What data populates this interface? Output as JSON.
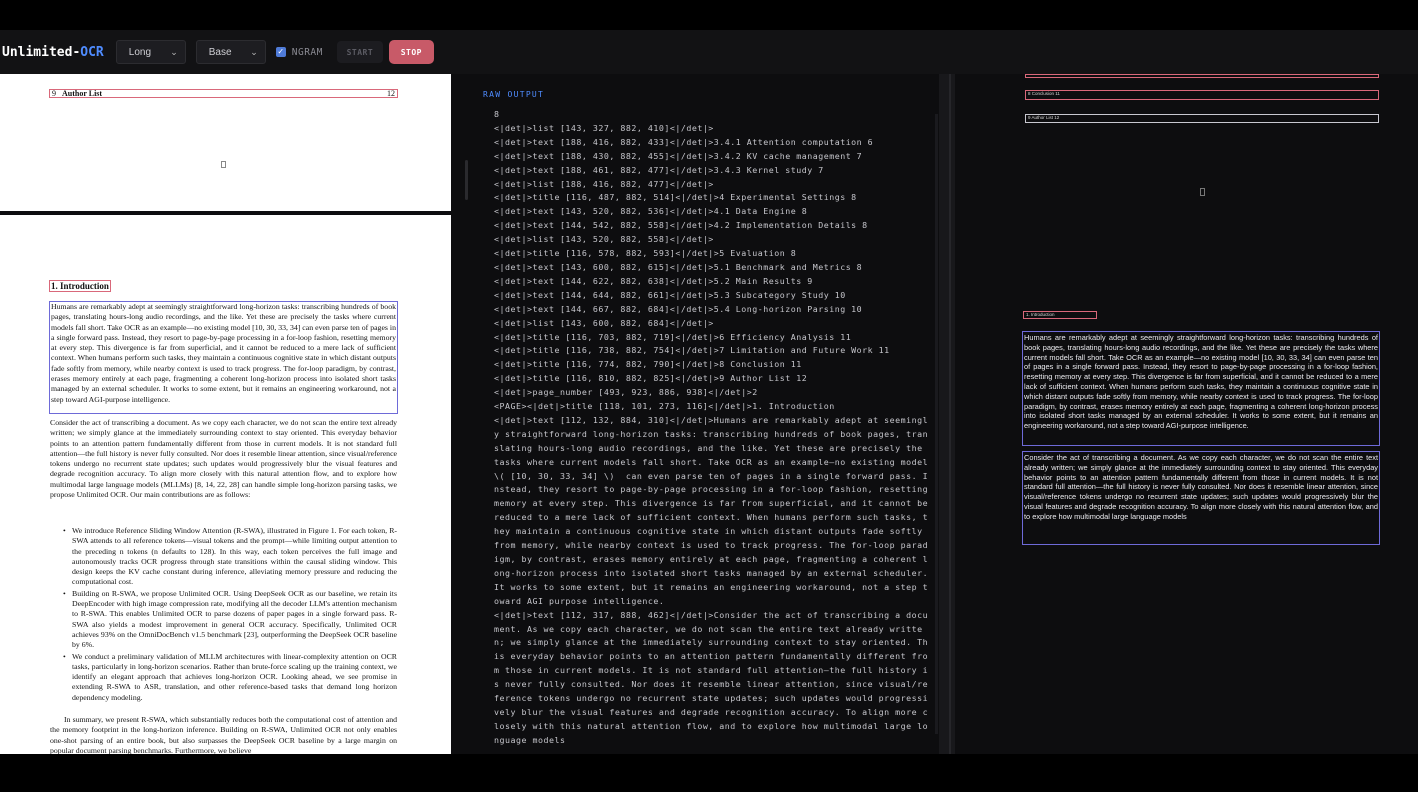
{
  "app": {
    "brand_prefix": "Unlimited-",
    "brand_accent": "OCR",
    "accent_color": "#4f8cff",
    "stop_color": "#c85a68"
  },
  "toolbar": {
    "mode_select": "Long",
    "model_select": "Base",
    "ngram_label": "NGRAM",
    "ngram_checked": true,
    "start_label": "START",
    "stop_label": "STOP"
  },
  "document": {
    "page1": {
      "author_list_num": "9",
      "author_list_title": "Author List",
      "author_list_page": "12"
    },
    "page2": {
      "intro_heading": "1.  Introduction",
      "intro_para": "Humans are remarkably adept at seemingly straightforward long-horizon tasks: transcribing hundreds of book pages, translating hours-long audio recordings, and the like. Yet these are precisely the tasks where current models fall short. Take OCR as an example—no existing model [10, 30, 33, 34] can even parse ten of pages in a single forward pass. Instead, they resort to page-by-page processing in a for-loop fashion, resetting memory at every step. This divergence is far from superficial, and it cannot be reduced to a mere lack of sufficient context. When humans perform such tasks, they maintain a continuous cognitive state in which distant outputs fade softly from memory, while nearby context is used to track progress. The for-loop paradigm, by contrast, erases memory entirely at each page, fragmenting a coherent long-horizon process into isolated short tasks managed by an external scheduler. It works to some extent, but it remains an engineering workaround, not a step toward AGI-purpose intelligence.",
      "consider_para": "Consider the act of transcribing a document. As we copy each character, we do not scan the entire text already written; we simply glance at the immediately surrounding context to stay oriented. This everyday behavior points to an attention pattern fundamentally different from those in current models. It is not standard full attention—the full history is never fully consulted. Nor does it resemble linear attention, since visual/reference tokens undergo no recurrent state updates; such updates would progressively blur the visual features and degrade recognition accuracy. To align more closely with this natural attention flow, and to explore how multimodal large language models (MLLMs) [8, 14, 22, 28] can handle simple long-horizon parsing tasks, we propose Unlimited OCR. Our main contributions are as follows:",
      "bullets": [
        "We introduce Reference Sliding Window Attention (R-SWA), illustrated in Figure 1. For each token, R-SWA attends to all reference tokens—visual tokens and the prompt—while limiting output attention to the preceding n tokens (n defaults to 128). In this way, each token perceives the full image and autonomously tracks OCR progress through state transitions within the causal sliding window. This design keeps the KV cache constant during inference, alleviating memory pressure and reducing the computational cost.",
        "Building on R-SWA, we propose Unlimited OCR. Using DeepSeek OCR as our baseline, we retain its DeepEncoder with high image compression rate, modifying all the decoder LLM's attention mechanism to R-SWA. This enables Unlimited OCR to parse dozens of paper pages in a single forward pass. R-SWA also yields a modest improvement in general OCR accuracy. Specifically, Unlimited OCR achieves 93% on the OmniDocBench v1.5 benchmark [23], outperforming the DeepSeek OCR baseline by 6%.",
        "We conduct a preliminary validation of MLLM architectures with linear-complexity attention on OCR tasks, particularly in long-horizon scenarios. Rather than brute-force scaling up the training context, we identify an elegant approach that achieves long-horizon OCR. Looking ahead, we see promise in extending R-SWA to ASR, translation, and other reference-based tasks that demand long horizon dependency modeling."
      ],
      "summary_para": "In summary, we present R-SWA, which substantially reduces both the computational cost of attention and the memory footprint in the long-horizon inference. Building on R-SWA, Unlimited OCR not only enables one-shot parsing of an entire book, but also surpasses the DeepSeek OCR baseline by a large margin on popular document parsing benchmarks. Furthermore, we believe"
    }
  },
  "raw_output": {
    "title": "RAW OUTPUT",
    "text": "8\n<|det|>list [143, 327, 882, 410]<|/det|>\n<|det|>text [188, 416, 882, 433]<|/det|>3.4.1 Attention computation 6\n<|det|>text [188, 430, 882, 455]<|/det|>3.4.2 KV cache management 7\n<|det|>text [188, 461, 882, 477]<|/det|>3.4.3 Kernel study 7\n<|det|>list [188, 416, 882, 477]<|/det|>\n<|det|>title [116, 487, 882, 514]<|/det|>4 Experimental Settings 8\n<|det|>text [143, 520, 882, 536]<|/det|>4.1 Data Engine 8\n<|det|>text [144, 542, 882, 558]<|/det|>4.2 Implementation Details 8\n<|det|>list [143, 520, 882, 558]<|/det|>\n<|det|>title [116, 578, 882, 593]<|/det|>5 Evaluation 8\n<|det|>text [143, 600, 882, 615]<|/det|>5.1 Benchmark and Metrics 8\n<|det|>text [144, 622, 882, 638]<|/det|>5.2 Main Results 9\n<|det|>text [144, 644, 882, 661]<|/det|>5.3 Subcategory Study 10\n<|det|>text [144, 667, 882, 684]<|/det|>5.4 Long-horizon Parsing 10\n<|det|>list [143, 600, 882, 684]<|/det|>\n<|det|>title [116, 703, 882, 719]<|/det|>6 Efficiency Analysis 11\n<|det|>title [116, 738, 882, 754]<|/det|>7 Limitation and Future Work 11\n<|det|>title [116, 774, 882, 790]<|/det|>8 Conclusion 11\n<|det|>title [116, 810, 882, 825]<|/det|>9 Author List 12\n<|det|>page_number [493, 923, 886, 938]<|/det|>2\n<PAGE><|det|>title [118, 101, 273, 116]<|/det|>1. Introduction\n<|det|>text [112, 132, 884, 310]<|/det|>Humans are remarkably adept at seemingl\ny straightforward long-horizon tasks: transcribing hundreds of book pages, tran\nslating hours-long audio recordings, and the like. Yet these are precisely the\ntasks where current models fall short. Take OCR as an example—no existing model\n\\( [10, 30, 33, 34] \\)  can even parse ten of pages in a single forward pass. I\nnstead, they resort to page-by-page processing in a for-loop fashion, resetting\nmemory at every step. This divergence is far from superficial, and it cannot be\nreduced to a mere lack of sufficient context. When humans perform such tasks, t\nhey maintain a continuous cognitive state in which distant outputs fade softly\nfrom memory, while nearby context is used to track progress. The for-loop parad\nigm, by contrast, erases memory entirely at each page, fragmenting a coherent l\nong-horizon process into isolated short tasks managed by an external scheduler.\nIt works to some extent, but it remains an engineering workaround, not a step t\noward AGI purpose intelligence.\n<|det|>text [112, 317, 888, 462]<|/det|>Consider the act of transcribing a docu\nment. As we copy each character, we do not scan the entire text already writte\nn; we simply glance at the immediately surrounding context to stay oriented. Th\nis everyday behavior points to an attention pattern fundamentally different fro\nm those in current models. It is not standard full attention—the full history i\ns never fully consulted. Nor does it resemble linear attention, since visual/re\nference tokens undergo no recurrent state updates; such updates would progressi\nvely blur the visual features and degrade recognition accuracy. To align more c\nlosely with this natural attention flow, and to explore how multimodal large lo\nnguage models"
  },
  "visualization": {
    "box_conclusion": "8 Conclusion 11",
    "box_author_list": "9 Author List 12",
    "box_introduction": "1. Introduction",
    "intro_text": "Humans are remarkably adept at seemingly straightforward long-horizon tasks: transcribing hundreds of book pages, translating hours-long audio recordings, and the like. Yet these are precisely the tasks where current models fall short. Take OCR as an example—no existing model [10, 30, 33, 34] can even parse ten of pages in a single forward pass. Instead, they resort to page-by-page processing in a for-loop fashion, resetting memory at every step. This divergence is far from superficial, and it cannot be reduced to a mere lack of sufficient context. When humans perform such tasks, they maintain a continuous cognitive state in which distant outputs fade softly from memory, while nearby context is used to track progress. The for-loop paradigm, by contrast, erases memory entirely at each page, fragmenting a coherent long-horizon process into isolated short tasks managed by an external scheduler. It works to some extent, but it remains an engineering workaround, not a step toward AGI-purpose intelligence.",
    "consider_text": "Consider the act of transcribing a document. As we copy each character, we do not scan the entire text already written; we simply glance at the immediately surrounding context to stay oriented. This everyday behavior points to an attention pattern fundamentally different from those in current models. It is not standard full attention—the full history is never fully consulted. Nor does it resemble linear attention, since visual/reference tokens undergo no recurrent state updates; such updates would progressively blur the visual features and degrade recognition accuracy. To align more closely with this natural attention flow, and to explore how multimodal large language models"
  }
}
